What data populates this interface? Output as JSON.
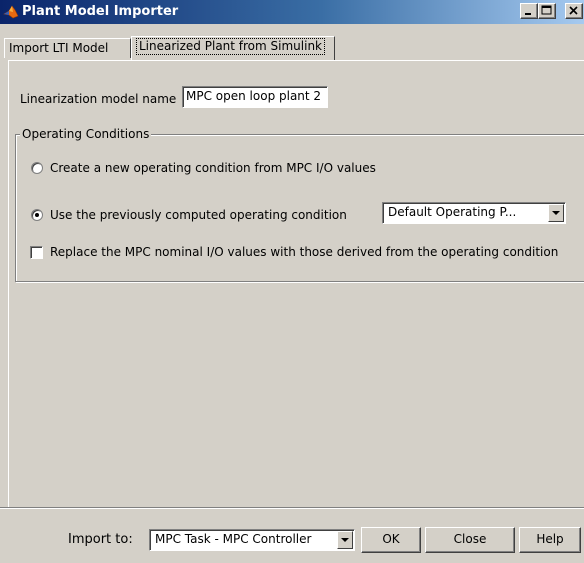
{
  "window": {
    "title": "Plant Model Importer"
  },
  "tabs": [
    {
      "label": "Import LTI Model",
      "active": false
    },
    {
      "label": "Linearized Plant from Simulink",
      "active": true
    }
  ],
  "form": {
    "model_name_label": "Linearization model name",
    "model_name_value": "MPC open loop plant 2"
  },
  "operating_conditions": {
    "group_title": "Operating Conditions",
    "option_new_label": "Create a new operating condition from MPC I/O values",
    "option_previous_label": "Use the previously computed operating condition",
    "option_selected": "previous",
    "operating_point_value": "Default Operating P...",
    "replace_nominal_label": "Replace the MPC nominal I/O values with those derived from the operating condition",
    "replace_nominal_checked": false
  },
  "footer": {
    "import_to_label": "Import to:",
    "import_to_value": "MPC Task - MPC Controller",
    "ok_label": "OK",
    "close_label": "Close",
    "help_label": "Help"
  },
  "colors": {
    "titlebar_start": "#0a246a",
    "titlebar_end": "#a6caf0",
    "face": "#d4d0c8"
  }
}
